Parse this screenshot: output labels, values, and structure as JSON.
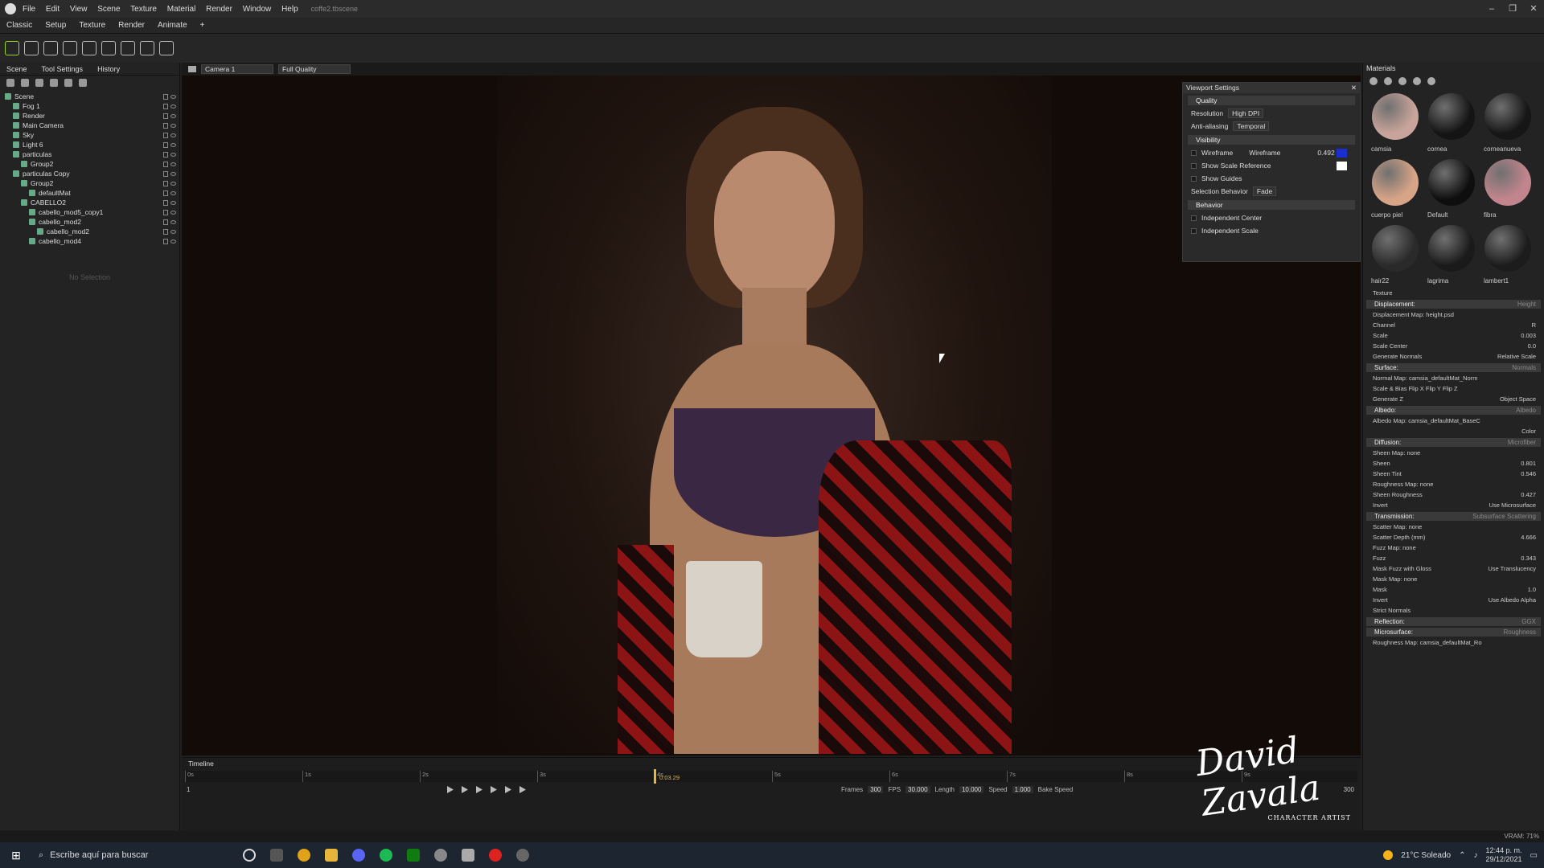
{
  "titlebar": {
    "menu": [
      "File",
      "Edit",
      "View",
      "Scene",
      "Texture",
      "Material",
      "Render",
      "Window",
      "Help"
    ],
    "filename": "coffe2.tbscene"
  },
  "modes": [
    "Classic",
    "Setup",
    "Texture",
    "Render",
    "Animate",
    "+"
  ],
  "left": {
    "tabs": [
      "Scene",
      "Tool Settings",
      "History"
    ],
    "tree": [
      "Scene",
      "Fog 1",
      "Render",
      "Main Camera",
      "Sky",
      "Light 6",
      "particulas",
      "Group2",
      "particulas Copy",
      "Group2",
      "defaultMat",
      "CABELLO2",
      "cabello_mod5_copy1",
      "cabello_mod2",
      "cabello_mod2",
      "cabello_mod4"
    ],
    "no_selection": "No Selection"
  },
  "viewport_bar": {
    "camera": "Camera 1",
    "quality": "Full Quality"
  },
  "viewport_settings": {
    "title": "Viewport Settings",
    "quality_label": "Quality",
    "resolution_label": "Resolution",
    "resolution": "High DPI",
    "aa_label": "Anti-aliasing",
    "aa": "Temporal",
    "visibility_label": "Visibility",
    "wireframe_label": "Wireframe",
    "wireframe_field": "Wireframe",
    "wireframe_value": "0.492",
    "scale_ref": "Show Scale Reference",
    "guides": "Show Guides",
    "selection_label": "Selection Behavior",
    "selection": "Fade",
    "behavior_label": "Behavior",
    "ind_center": "Independent Center",
    "ind_scale": "Independent Scale",
    "wire_color": "#1a2fd0",
    "scale_color": "#ffffff"
  },
  "materials": {
    "header": "Materials",
    "items": [
      {
        "name": "camsia",
        "color": "#c9a49a"
      },
      {
        "name": "cornea",
        "color": "#141414"
      },
      {
        "name": "corneanueva",
        "color": "#161616"
      },
      {
        "name": "cuerpo piel",
        "color": "#d8a487"
      },
      {
        "name": "Default",
        "color": "#0e0e0e"
      },
      {
        "name": "fibra",
        "color": "#c3858d"
      },
      {
        "name": "hair22",
        "color": "#2a2a2a"
      },
      {
        "name": "lagrima",
        "color": "#1a1a1a"
      },
      {
        "name": "lambert1",
        "color": "#1c1c1c"
      }
    ]
  },
  "properties": {
    "texture": "Texture",
    "displacement": "Displacement:",
    "disp_mode": "Height",
    "disp_map": "Displacement Map: height.psd",
    "channel": "Channel",
    "channel_val": "R",
    "scale": "Scale",
    "scale_val": "0.003",
    "scale_center": "Scale Center",
    "scale_center_val": "0.0",
    "gen_normals": "Generate Normals",
    "rel_scale": "Relative Scale",
    "surface": "Surface:",
    "surface_mode": "Normals",
    "normal_map": "Normal Map: camsia_defaultMat_Norm",
    "scale_bias": "Scale & Bias   Flip X   Flip Y   Flip Z",
    "gen_z": "Generate Z",
    "obj_space": "Object Space",
    "albedo": "Albedo:",
    "albedo_mode": "Albedo",
    "albedo_map": "Albedo Map: camsia_defaultMat_BaseC",
    "color": "Color",
    "diffusion": "Diffusion:",
    "diff_mode": "Microfiber",
    "sheen_map": "Sheen Map: none",
    "sheen": "Sheen",
    "sheen_val": "0.801",
    "sheen_tint": "Sheen Tint",
    "sheen_tint_val": "0.546",
    "rough_map": "Roughness Map: none",
    "sheen_rough": "Sheen Roughness",
    "sheen_rough_val": "0.427",
    "invert": "Invert",
    "use_micro": "Use Microsurface",
    "transmission": "Transmission:",
    "trans_mode": "Subsurface Scattering",
    "scatter_map": "Scatter Map: none",
    "scatter_depth": "Scatter Depth (mm)",
    "scatter_depth_val": "4.666",
    "fuzz_map": "Fuzz Map: none",
    "fuzz": "Fuzz",
    "fuzz_val": "0.343",
    "mask_fuzz": "Mask Fuzz with Gloss",
    "use_transl": "Use Translucency",
    "mask_map": "Mask Map: none",
    "mask": "Mask",
    "mask_val": "1.0",
    "invert2": "Invert",
    "use_albedo_alpha": "Use Albedo Alpha",
    "strict_normals": "Strict Normals",
    "reflection": "Reflection:",
    "refl_mode": "GGX",
    "microsurface": "Microsurface:",
    "micro_mode": "Roughness",
    "rough_map2": "Roughness Map: camsia_defaultMat_Ro"
  },
  "timeline": {
    "label": "Timeline",
    "ticks": [
      "0s",
      "1s",
      "2s",
      "3s",
      "4s",
      "5s",
      "6s",
      "7s",
      "8s",
      "9s"
    ],
    "current": "0:03.29",
    "start": "1",
    "frames_label": "Frames",
    "frames": "300",
    "fps_label": "FPS",
    "fps": "30.000",
    "length_label": "Length",
    "length": "10.000",
    "speed_label": "Speed",
    "speed": "1.000",
    "bake": "Bake Speed",
    "end": "300"
  },
  "signature": {
    "name": "David Zavala",
    "sub": "CHARACTER ARTIST"
  },
  "status": {
    "vram": "VRAM: 71%"
  },
  "taskbar": {
    "search": "Escribe aquí para buscar",
    "weather": "21°C  Soleado",
    "time": "12:44 p. m.",
    "date": "29/12/2021"
  }
}
